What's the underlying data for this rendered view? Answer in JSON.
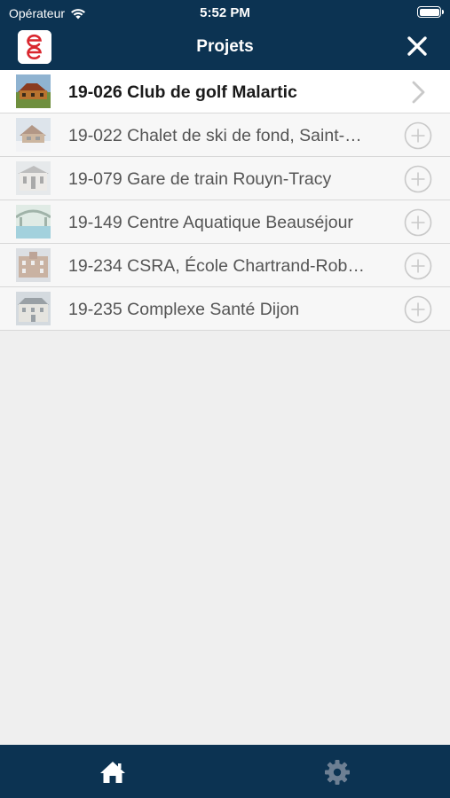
{
  "status_bar": {
    "carrier": "Opérateur",
    "time": "5:52 PM"
  },
  "navbar": {
    "title": "Projets",
    "logo_icon": "ee-logo",
    "close_icon": "close-icon"
  },
  "projects": [
    {
      "label": "19-026 Club de golf Malartic",
      "selected": true,
      "action_icon": "chevron-right-icon"
    },
    {
      "label": "19-022 Chalet de ski de fond, Saint-…",
      "selected": false,
      "action_icon": "add-circle-icon"
    },
    {
      "label": "19-079 Gare de train Rouyn-Tracy",
      "selected": false,
      "action_icon": "add-circle-icon"
    },
    {
      "label": "19-149 Centre Aquatique Beauséjour",
      "selected": false,
      "action_icon": "add-circle-icon"
    },
    {
      "label": "19-234 CSRA, École Chartrand-Rob…",
      "selected": false,
      "action_icon": "add-circle-icon"
    },
    {
      "label": "19-235 Complexe Santé Dijon",
      "selected": false,
      "action_icon": "add-circle-icon"
    }
  ],
  "tabbar": {
    "items": [
      {
        "icon": "home-icon",
        "active": true
      },
      {
        "icon": "gear-icon",
        "active": false
      }
    ]
  },
  "colors": {
    "brand_navy": "#0c3352",
    "logo_red": "#d9262e",
    "tab_active": "#ffffff",
    "tab_inactive": "#6d7f93"
  }
}
